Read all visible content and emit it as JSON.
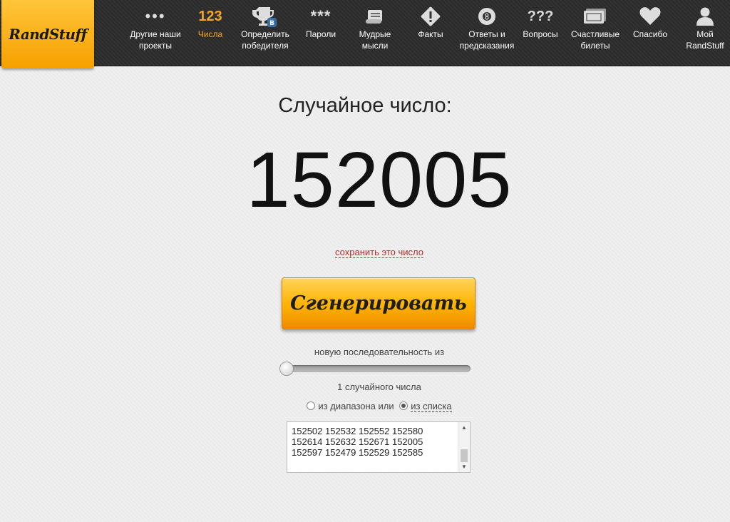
{
  "logo": {
    "text": "RandStuff"
  },
  "nav": [
    {
      "label": "Другие наши\nпроекты",
      "icon": "more-dots-icon"
    },
    {
      "label": "Числа",
      "icon": "numbers-123-icon",
      "active": true
    },
    {
      "label": "Определить\nпобедителя",
      "icon": "trophy-vk-icon"
    },
    {
      "label": "Пароли",
      "icon": "password-stars-icon"
    },
    {
      "label": "Мудрые\nмысли",
      "icon": "scroll-icon"
    },
    {
      "label": "Факты",
      "icon": "exclamation-icon"
    },
    {
      "label": "Ответы и\nпредсказания",
      "icon": "magic-8-ball-icon"
    },
    {
      "label": "Вопросы",
      "icon": "question-marks-icon"
    },
    {
      "label": "Счастливые\nбилеты",
      "icon": "tickets-icon"
    },
    {
      "label": "Спасибо",
      "icon": "heart-icon"
    },
    {
      "label": "Мой\nRandStuff",
      "icon": "user-icon"
    }
  ],
  "icon_texts": {
    "numbers": "123",
    "password": "***",
    "questions": "???",
    "dots": "•••",
    "trophy_badge": "B"
  },
  "main": {
    "title": "Случайное число:",
    "number": "152005",
    "save_link": "сохранить это число",
    "generate_button": "Сгенерировать",
    "sequence_label": "новую последовательность из",
    "count_label": "1 случайного числа",
    "range_option": "из диапазона или",
    "list_option": "из списка",
    "count_value": 1
  },
  "list": {
    "lines": [
      "152502 152532 152552 152580",
      "152614 152632 152671 152005",
      "152597 152479 152529 152585"
    ]
  },
  "colors": {
    "accent": "#f5a623",
    "link": "#b52e2e",
    "nav_bg": "#2e2e2e"
  }
}
